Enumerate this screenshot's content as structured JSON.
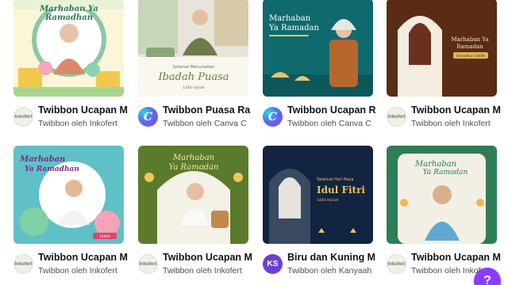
{
  "templates": [
    {
      "title": "Twibbon Ucapan M",
      "author": "Twibbon oleh Inkofert",
      "avatar_text": "Inkofert",
      "art_text": [
        "Marhaban Ya",
        "Ramadhan"
      ]
    },
    {
      "title": "Twibbon Puasa Ra",
      "author": "Twibbon oleh Canva C",
      "avatar_text": "C",
      "art_text": [
        "Selamat Menunaikan",
        "Ibadah Puasa",
        "1444 Hijriah"
      ]
    },
    {
      "title": "Twibbon Ucapan R",
      "author": "Twibbon oleh Canva C",
      "avatar_text": "C",
      "art_text": [
        "Marhaban",
        "Ya Ramadan"
      ]
    },
    {
      "title": "Twibbon Ucapan M",
      "author": "Twibbon oleh Inkofert",
      "avatar_text": "Inkofert",
      "art_text": [
        "Marhaban Ya",
        "Ramadan",
        "Ramadhan 1444H"
      ]
    },
    {
      "title": "Twibbon Ucapan M",
      "author": "Twibbon oleh Inkofert",
      "avatar_text": "Inkofert",
      "art_text": [
        "Marhaban",
        "Ya Ramadhan",
        "1444H"
      ]
    },
    {
      "title": "Twibbon Ucapan M",
      "author": "Twibbon oleh Inkofert",
      "avatar_text": "Inkofert",
      "art_text": [
        "Marhaban",
        "Ya Ramadan"
      ]
    },
    {
      "title": "Biru dan Kuning M",
      "author": "Twibbon oleh Kanyaah",
      "avatar_text": "KS",
      "art_text": [
        "Selamat Hari Raya",
        "Idul Fitri",
        "1444 Hijriah"
      ]
    },
    {
      "title": "Twibbon Ucapan M",
      "author": "Twibbon oleh Inkofert",
      "avatar_text": "Inkofert",
      "art_text": [
        "Marhaban",
        "Ya Ramadan"
      ]
    }
  ],
  "help": {
    "label": "?"
  },
  "colors": {
    "help_purple": "#8b3dff",
    "title_text": "#0e1318",
    "sub_text": "#4a4f55"
  }
}
